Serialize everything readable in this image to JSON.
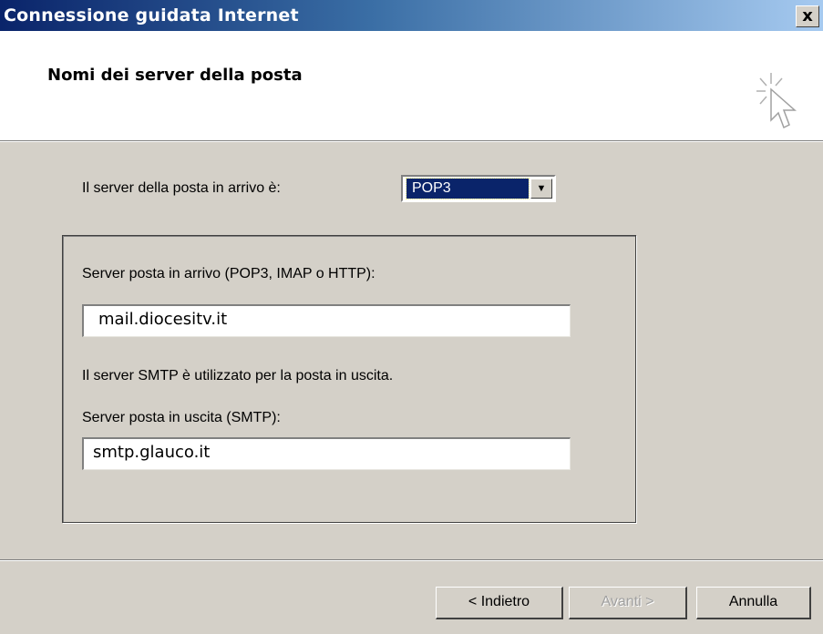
{
  "window": {
    "title": "Connessione guidata Internet",
    "close_label": "x"
  },
  "header": {
    "title": "Nomi dei server della posta",
    "icon": "wizard-cursor-icon"
  },
  "incoming": {
    "type_label": "Il server della posta in arrivo è:",
    "type_selected": "POP3",
    "dropdown_icon": "chevron-down-icon"
  },
  "group": {
    "incoming_label": "Server posta in arrivo (POP3, IMAP o HTTP):",
    "incoming_value": "mail.diocesitv.it",
    "smtp_note": "Il server SMTP è utilizzato per la posta in uscita.",
    "outgoing_label": "Server posta in uscita (SMTP):",
    "outgoing_value": "smtp.glauco.it"
  },
  "buttons": {
    "back": "< Indietro",
    "next": "Avanti >",
    "cancel": "Annulla"
  }
}
